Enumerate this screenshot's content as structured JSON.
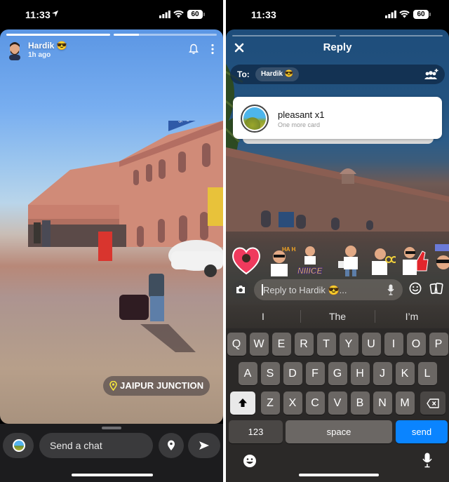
{
  "left_screen": {
    "status_bar": {
      "time": "11:33",
      "battery": "60",
      "location_icon": "location-arrow-icon"
    },
    "story": {
      "progress_segments": [
        1.0,
        0.25
      ],
      "user_name": "Hardik 😎",
      "posted_ago": "1h ago",
      "location_sticker": "JAIPUR JUNCTION",
      "sign_text": "जयपुर ज"
    },
    "chat_bar": {
      "placeholder": "Send a chat"
    }
  },
  "right_screen": {
    "status_bar": {
      "time": "11:33",
      "battery": "60"
    },
    "header": {
      "title": "Reply"
    },
    "to_field": {
      "label": "To:",
      "recipient": "Hardik 😎"
    },
    "card": {
      "title": "pleasant x1",
      "subtitle": "One more card"
    },
    "stickers": [
      "heart-sticker",
      "haha-sticker",
      "niiice-sticker",
      "coffee-sticker",
      "glasses-sticker",
      "thumbs-up-sticker",
      "whoa-sticker"
    ],
    "stickers_text": {
      "haha": "HA HA",
      "niiice": "NIIICE"
    },
    "reply_input": {
      "placeholder": "Reply to Hardik 😎..."
    },
    "keyboard": {
      "suggestions": [
        "I",
        "The",
        "I’m"
      ],
      "row1": [
        "Q",
        "W",
        "E",
        "R",
        "T",
        "Y",
        "U",
        "I",
        "O",
        "P"
      ],
      "row2": [
        "A",
        "S",
        "D",
        "F",
        "G",
        "H",
        "J",
        "K",
        "L"
      ],
      "row3": [
        "Z",
        "X",
        "C",
        "V",
        "B",
        "N",
        "M"
      ],
      "num_label": "123",
      "space_label": "space",
      "send_label": "send"
    }
  },
  "colors": {
    "send_key": "#0a84ff",
    "location_pin": "#f5e63c"
  }
}
